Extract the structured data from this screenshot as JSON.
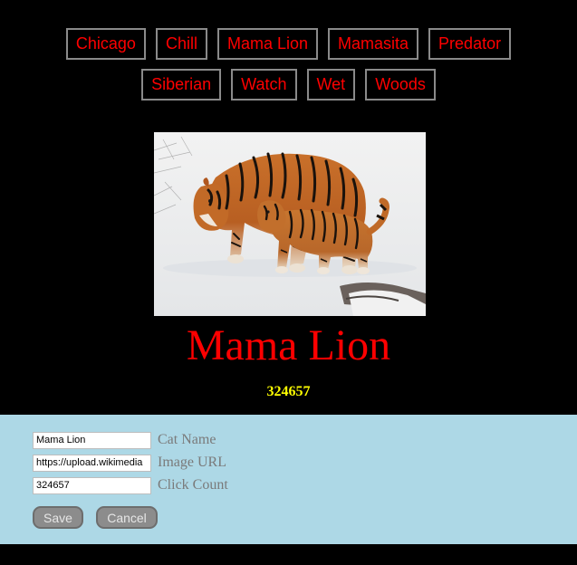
{
  "cat_list": [
    {
      "label": "Chicago"
    },
    {
      "label": "Chill"
    },
    {
      "label": "Mama Lion"
    },
    {
      "label": "Mamasita"
    },
    {
      "label": "Predator"
    },
    {
      "label": "Siberian"
    },
    {
      "label": "Watch"
    },
    {
      "label": "Wet"
    },
    {
      "label": "Woods"
    }
  ],
  "current_cat": {
    "name": "Mama Lion",
    "click_count": "324657",
    "image_alt": "Tiger mother and cub walking in snow"
  },
  "admin": {
    "name_value": "Mama Lion",
    "name_label": "Cat Name",
    "url_value": "https://upload.wikimedia",
    "url_label": "Image URL",
    "count_value": "324657",
    "count_label": "Click Count",
    "save_label": "Save",
    "cancel_label": "Cancel"
  },
  "colors": {
    "page_background": "#000000",
    "button_text": "#ff0000",
    "cat_name": "#ff0000",
    "click_count": "#ffff00",
    "admin_background": "#add8e6"
  }
}
